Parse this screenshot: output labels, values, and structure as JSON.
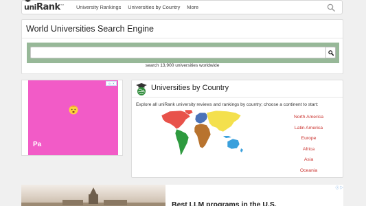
{
  "navbar": {
    "logo": {
      "part1": "uni",
      "part2": "Rank",
      "tm": "TM"
    },
    "links": [
      "University Rankings",
      "Universities by Country",
      "More"
    ]
  },
  "search": {
    "title": "World Universities Search Engine",
    "input_value": "",
    "caption": "search 13,900 universities worldwide"
  },
  "ad_left": {
    "badge": "i ▷ ✕",
    "text": "Pa"
  },
  "country": {
    "title": "Universities by Country",
    "description": "Explore all uniRank university reviews and rankings by country; choose a continent to start:",
    "continents": [
      "North America",
      "Latin America",
      "Europe",
      "Africa",
      "Asia",
      "Oceania"
    ]
  },
  "ad_bottom": {
    "title": "Best LLM programs in the U.S.",
    "badge": "ⓘ ▷"
  },
  "colors": {
    "search_band": "#97b898",
    "continent_link": "#c9302c",
    "north_america": "#e8524a",
    "latin_america": "#2e9a3f",
    "europe": "#4a72b8",
    "africa": "#b8732e",
    "asia": "#f4e04d",
    "oceania": "#3aa0dc",
    "ad_pink": "#f25bc7"
  },
  "icons": [
    "search-icon",
    "graduation-cap-globe-icon",
    "emoji-face-icon"
  ]
}
